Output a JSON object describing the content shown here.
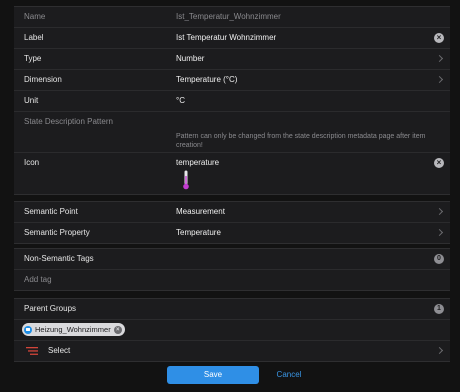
{
  "fields": {
    "name": {
      "label": "Name",
      "value": "Ist_Temperatur_Wohnzimmer"
    },
    "label": {
      "label": "Label",
      "value": "Ist Temperatur Wohnzimmer"
    },
    "type": {
      "label": "Type",
      "value": "Number"
    },
    "dimension": {
      "label": "Dimension",
      "value": "Temperature (°C)"
    },
    "unit": {
      "label": "Unit",
      "value": "°C"
    },
    "state_description": {
      "label": "State Description Pattern",
      "hint": "Pattern can only be changed from the state description metadata page after item creation!"
    },
    "icon": {
      "label": "Icon",
      "value": "temperature"
    }
  },
  "semantics": {
    "point": {
      "label": "Semantic Point",
      "value": "Measurement"
    },
    "property": {
      "label": "Semantic Property",
      "value": "Temperature"
    }
  },
  "tags": {
    "label": "Non-Semantic Tags",
    "count": "0",
    "add_placeholder": "Add tag"
  },
  "parent_groups": {
    "label": "Parent Groups",
    "count": "1",
    "chip": "Heizung_Wohnzimmer",
    "select_label": "Select"
  },
  "actions": {
    "save": "Save",
    "cancel": "Cancel"
  },
  "colors": {
    "accent": "#2f8fe6",
    "background": "#121212",
    "panel": "#1c1c1e",
    "thermometer": "#c23bd0"
  }
}
